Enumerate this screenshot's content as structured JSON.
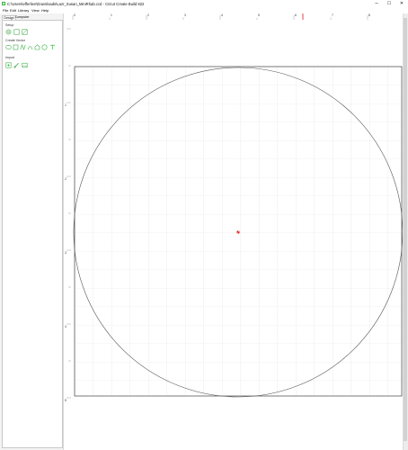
{
  "window": {
    "title": "C:\\Users\\efferlien\\Downloads\\Lazr_Susan_MiniRhab.ccd - Cricut Create Build 822",
    "minimize_glyph": "–",
    "maximize_glyph": "☐",
    "close_glyph": "✕"
  },
  "menu": {
    "items": [
      "File",
      "Edit",
      "Library",
      "View",
      "Help"
    ]
  },
  "panel": {
    "tabs": [
      "Design",
      "Computer"
    ],
    "sections": {
      "setup": "Setup",
      "create_vector": "Create Vector",
      "import": "Import"
    }
  },
  "icons": {
    "setup": [
      "settings-icon",
      "rectangle-tool-icon",
      "image-tool-icon"
    ],
    "create_vector": [
      "ellipse-tool-icon",
      "square-tool-icon",
      "line-tool-icon",
      "arc-tool-icon",
      "house-shape-icon",
      "circle-tool-icon",
      "text-tool-icon"
    ],
    "import": [
      "import-image-icon",
      "brush-tool-icon",
      "picture-icon"
    ]
  },
  "colors": {
    "accent": "#3fae49",
    "grid": "#e2e2e2",
    "circle": "#555555",
    "marker": "#d81b1b"
  },
  "rulers": {
    "top_labels": [
      "0",
      "1",
      "2",
      "3",
      "4",
      "5",
      "6",
      "7",
      "8"
    ],
    "left_labels": [
      "1",
      "2",
      "3",
      "4",
      "5"
    ]
  }
}
